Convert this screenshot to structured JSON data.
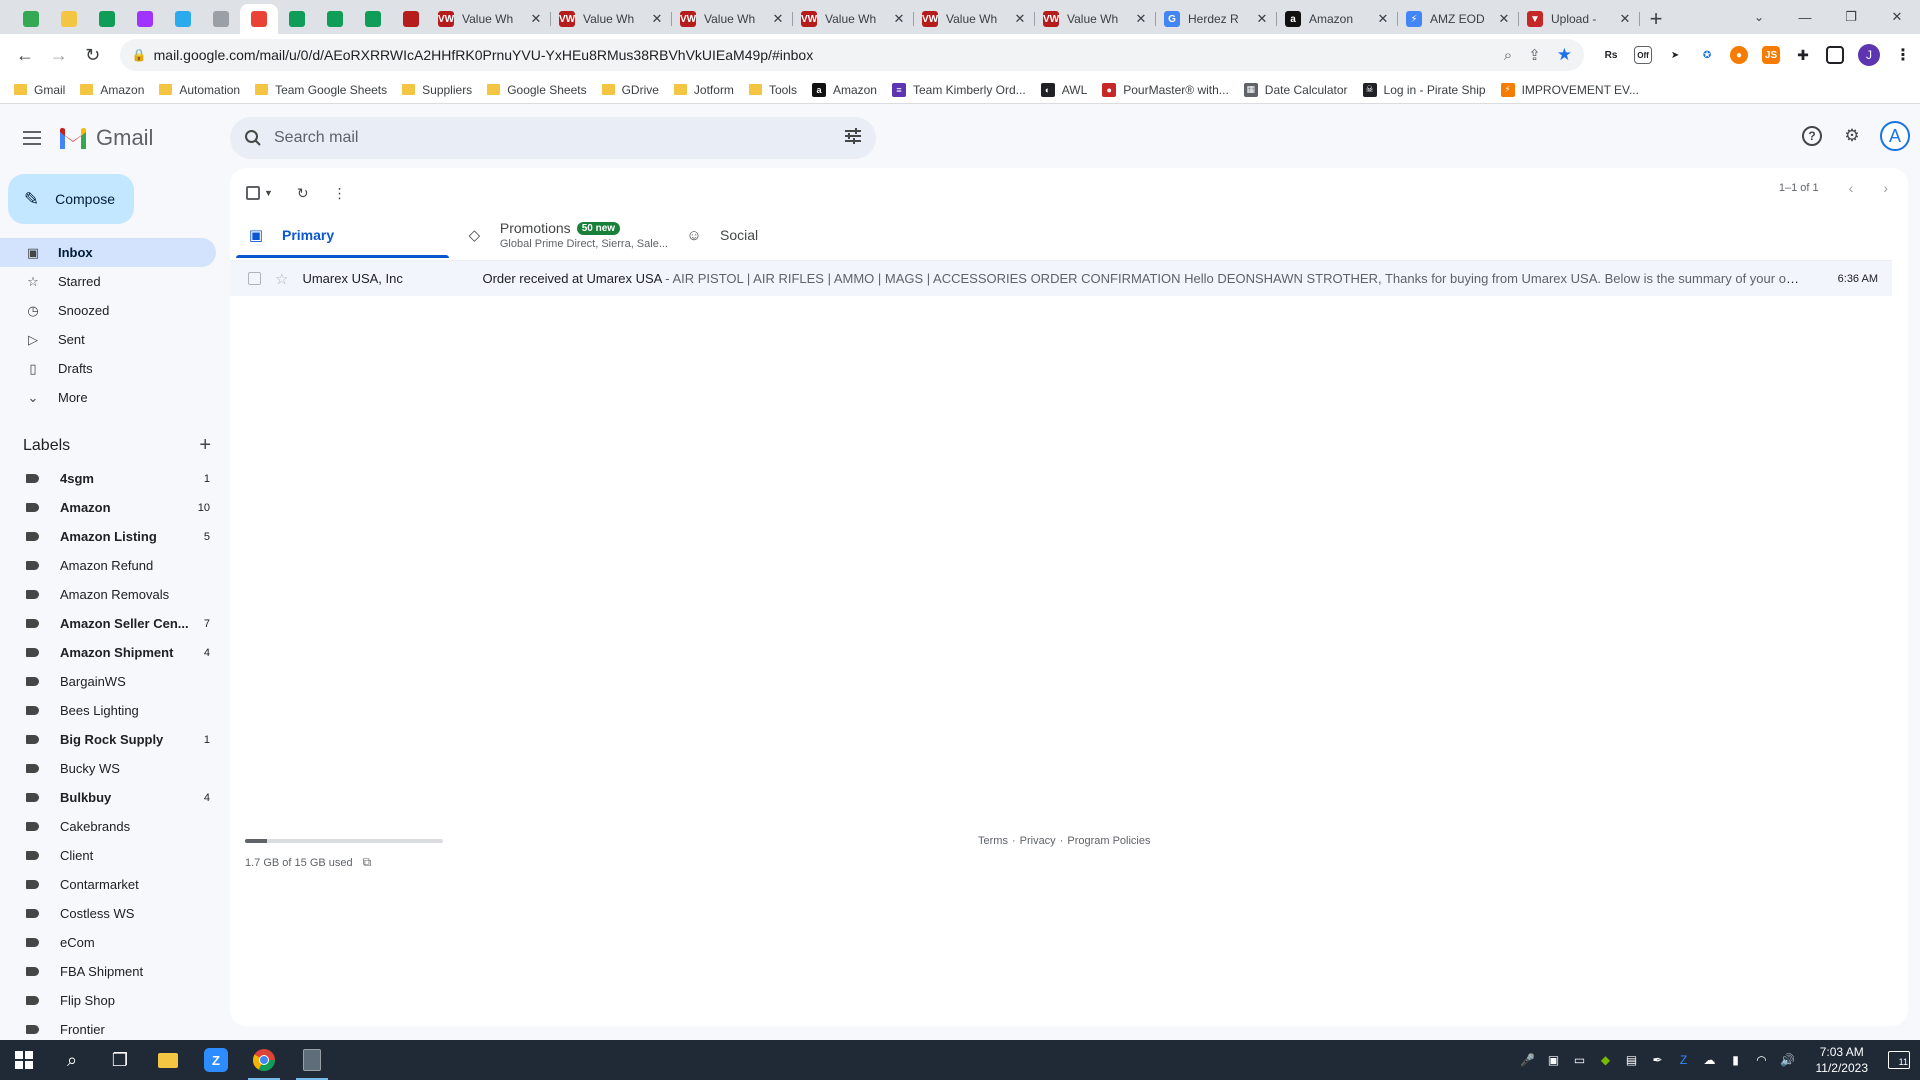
{
  "browser": {
    "pinned_tabs": [
      {
        "icon": "refresh-green-icon",
        "color": "#34a853"
      },
      {
        "icon": "note-yellow-icon",
        "color": "#f4c542"
      },
      {
        "icon": "sheets-icon",
        "color": "#0f9d58"
      },
      {
        "icon": "messenger-icon",
        "color": "#a033ff"
      },
      {
        "icon": "telegram-icon",
        "color": "#2aabee"
      },
      {
        "icon": "signature-icon",
        "color": "#9aa0a6"
      },
      {
        "icon": "gmail-icon",
        "color": "#ea4335"
      },
      {
        "icon": "sheets-icon",
        "color": "#0f9d58"
      },
      {
        "icon": "sheets-icon",
        "color": "#0f9d58"
      },
      {
        "icon": "sheets-icon",
        "color": "#0f9d58"
      },
      {
        "icon": "vw-icon",
        "color": "#b71c1c"
      }
    ],
    "tabs": [
      {
        "title": "Value Wh",
        "icon": "VW",
        "color": "#b71c1c"
      },
      {
        "title": "Value Wh",
        "icon": "VW",
        "color": "#b71c1c"
      },
      {
        "title": "Value Wh",
        "icon": "VW",
        "color": "#b71c1c"
      },
      {
        "title": "Value Wh",
        "icon": "VW",
        "color": "#b71c1c"
      },
      {
        "title": "Value Wh",
        "icon": "VW",
        "color": "#b71c1c"
      },
      {
        "title": "Value Wh",
        "icon": "VW",
        "color": "#b71c1c"
      },
      {
        "title": "Herdez R",
        "icon": "G",
        "color": "#4285f4"
      },
      {
        "title": "Amazon",
        "icon": "a",
        "color": "#111111"
      },
      {
        "title": "AMZ EOD",
        "icon": "⚡",
        "color": "#4285f4"
      },
      {
        "title": "Upload -",
        "icon": "▼",
        "color": "#c62828"
      }
    ],
    "url": "mail.google.com/mail/u/0/d/AEoRXRRWIcA2HHfRK0PrnuYVU-YxHEu8RMus38RBVhVkUIEaM49p/#inbox",
    "profile_initial": "J",
    "bookmarks": [
      {
        "label": "Gmail",
        "type": "folder"
      },
      {
        "label": "Amazon",
        "type": "folder"
      },
      {
        "label": "Automation",
        "type": "folder"
      },
      {
        "label": "Team Google Sheets",
        "type": "folder"
      },
      {
        "label": "Suppliers",
        "type": "folder"
      },
      {
        "label": "Google Sheets",
        "type": "folder"
      },
      {
        "label": "GDrive",
        "type": "folder"
      },
      {
        "label": "Jotform",
        "type": "folder"
      },
      {
        "label": "Tools",
        "type": "folder"
      },
      {
        "label": "Amazon",
        "type": "site",
        "icon": "a",
        "color": "#111111"
      },
      {
        "label": "Team Kimberly Ord...",
        "type": "site",
        "icon": "≡",
        "color": "#5e35b1"
      },
      {
        "label": "AWL",
        "type": "site",
        "icon": "◐",
        "color": "#202124"
      },
      {
        "label": "PourMaster® with...",
        "type": "site",
        "icon": "●",
        "color": "#c62828"
      },
      {
        "label": "Date Calculator",
        "type": "site",
        "icon": "▦",
        "color": "#5f6368"
      },
      {
        "label": "Log in - Pirate Ship",
        "type": "site",
        "icon": "☠",
        "color": "#202124"
      },
      {
        "label": "IMPROVEMENT EV...",
        "type": "site",
        "icon": "⚡",
        "color": "#f57c00"
      }
    ]
  },
  "gmail": {
    "logo_text": "Gmail",
    "search_placeholder": "Search mail",
    "account_initial": "A",
    "compose_label": "Compose",
    "nav": [
      {
        "label": "Inbox",
        "icon": "inbox-icon",
        "glyph": "▣",
        "active": true
      },
      {
        "label": "Starred",
        "icon": "star-icon",
        "glyph": "☆",
        "active": false
      },
      {
        "label": "Snoozed",
        "icon": "clock-icon",
        "glyph": "◷",
        "active": false
      },
      {
        "label": "Sent",
        "icon": "send-icon",
        "glyph": "▷",
        "active": false
      },
      {
        "label": "Drafts",
        "icon": "draft-icon",
        "glyph": "▯",
        "active": false
      },
      {
        "label": "More",
        "icon": "chevron-down-icon",
        "glyph": "⌄",
        "active": false
      }
    ],
    "labels_heading": "Labels",
    "labels": [
      {
        "name": "4sgm",
        "count": "1",
        "bold": true
      },
      {
        "name": "Amazon",
        "count": "10",
        "bold": true
      },
      {
        "name": "Amazon Listing",
        "count": "5",
        "bold": true
      },
      {
        "name": "Amazon Refund",
        "count": "",
        "bold": false
      },
      {
        "name": "Amazon Removals",
        "count": "",
        "bold": false
      },
      {
        "name": "Amazon Seller Cen...",
        "count": "7",
        "bold": true
      },
      {
        "name": "Amazon Shipment",
        "count": "4",
        "bold": true
      },
      {
        "name": "BargainWS",
        "count": "",
        "bold": false
      },
      {
        "name": "Bees Lighting",
        "count": "",
        "bold": false
      },
      {
        "name": "Big Rock Supply",
        "count": "1",
        "bold": true
      },
      {
        "name": "Bucky WS",
        "count": "",
        "bold": false
      },
      {
        "name": "Bulkbuy",
        "count": "4",
        "bold": true
      },
      {
        "name": "Cakebrands",
        "count": "",
        "bold": false
      },
      {
        "name": "Client",
        "count": "",
        "bold": false
      },
      {
        "name": "Contarmarket",
        "count": "",
        "bold": false
      },
      {
        "name": "Costless WS",
        "count": "",
        "bold": false
      },
      {
        "name": "eCom",
        "count": "",
        "bold": false
      },
      {
        "name": "FBA Shipment",
        "count": "",
        "bold": false
      },
      {
        "name": "Flip Shop",
        "count": "",
        "bold": false
      },
      {
        "name": "Frontier",
        "count": "",
        "bold": false
      }
    ],
    "pager_text": "1–1 of 1",
    "tabs": [
      {
        "label": "Primary",
        "icon": "inbox-icon",
        "glyph": "▣",
        "active": true,
        "badge": "",
        "sub": ""
      },
      {
        "label": "Promotions",
        "icon": "tag-icon",
        "glyph": "◇",
        "active": false,
        "badge": "50 new",
        "sub": "Global Prime Direct, Sierra, Sale..."
      },
      {
        "label": "Social",
        "icon": "people-icon",
        "glyph": "☺",
        "active": false,
        "badge": "",
        "sub": ""
      }
    ],
    "emails": [
      {
        "sender": "Umarex USA, Inc",
        "subject": "Order received at Umarex USA",
        "snippet": " - AIR PISTOL | AIR RIFLES | AMMO | MAGS | ACCESSORIES ORDER CONFIRMATION Hello DEONSHAWN STROTHER, Thanks for buying from Umarex USA. Below is the summary of your order. Order D...",
        "time": "6:36 AM"
      }
    ],
    "storage_text": "1.7 GB of 15 GB used",
    "storage_used_fraction": 0.113,
    "footer": {
      "terms": "Terms",
      "sep1": "·",
      "privacy": "Privacy",
      "sep2": "·",
      "policies": "Program Policies"
    }
  },
  "taskbar": {
    "time": "7:03 AM",
    "date": "11/2/2023",
    "notification_count": "11"
  }
}
